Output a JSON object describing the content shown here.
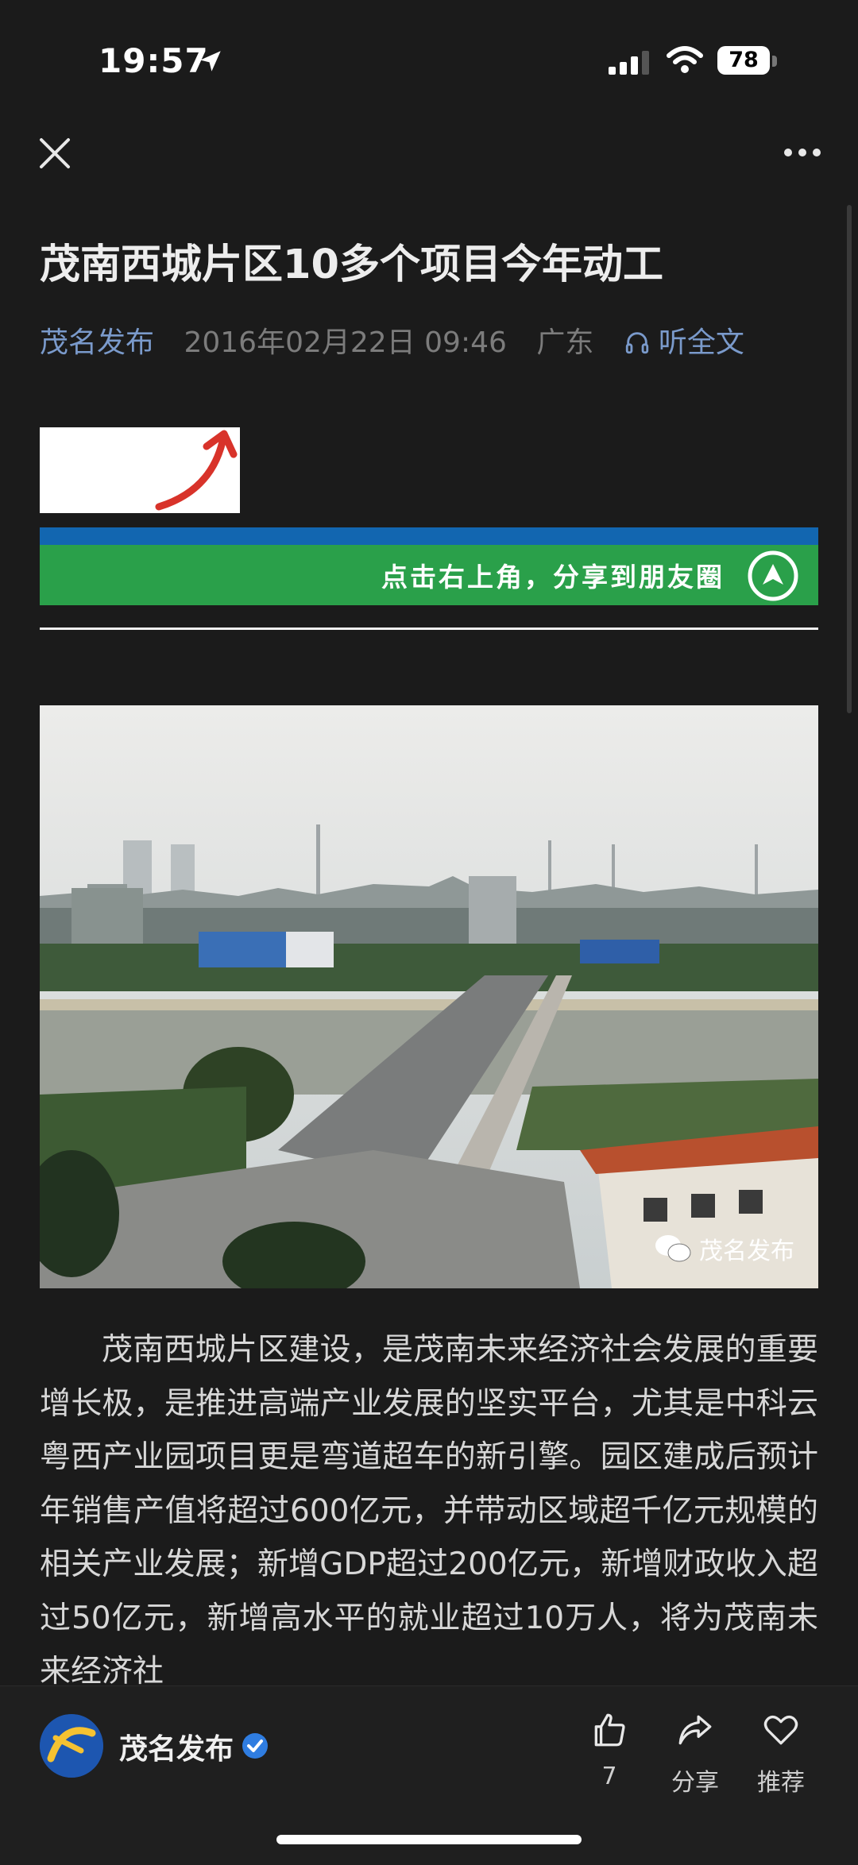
{
  "status_bar": {
    "time": "19:57",
    "battery": "78"
  },
  "article": {
    "title": "茂南西城片区10多个项目今年动工",
    "source": "茂名发布",
    "date": "2016年02月22日 09:46",
    "region": "广东",
    "listen_label": "听全文",
    "banner_text": "点击右上角，分享到朋友圈",
    "photo_watermark": "茂名发布",
    "body": "茂南西城片区建设，是茂南未来经济社会发展的重要增长极，是推进高端产业发展的坚实平台，尤其是中科云粤西产业园项目更是弯道超车的新引擎。园区建成后预计年销售产值将超过600亿元，并带动区域超千亿元规模的相关产业发展；新增GDP超过200亿元，新增财政收入超过50亿元，新增高水平的就业超过10万人，将为茂南未来经济社"
  },
  "bottom_bar": {
    "account_name": "茂名发布",
    "like_count": "7",
    "share_label": "分享",
    "recommend_label": "推荐"
  },
  "icons": [
    "close-icon",
    "more-icon",
    "headphone-icon",
    "wechat-icon",
    "like-icon",
    "share-icon",
    "heart-icon",
    "verified-icon",
    "location-arrow-icon",
    "signal-icon",
    "wifi-icon"
  ],
  "colors": {
    "background": "#1b1b1b",
    "link": "#7a9acb",
    "banner_green": "#2aa04a",
    "banner_blue": "#1266b0",
    "verified": "#2f7de1"
  }
}
